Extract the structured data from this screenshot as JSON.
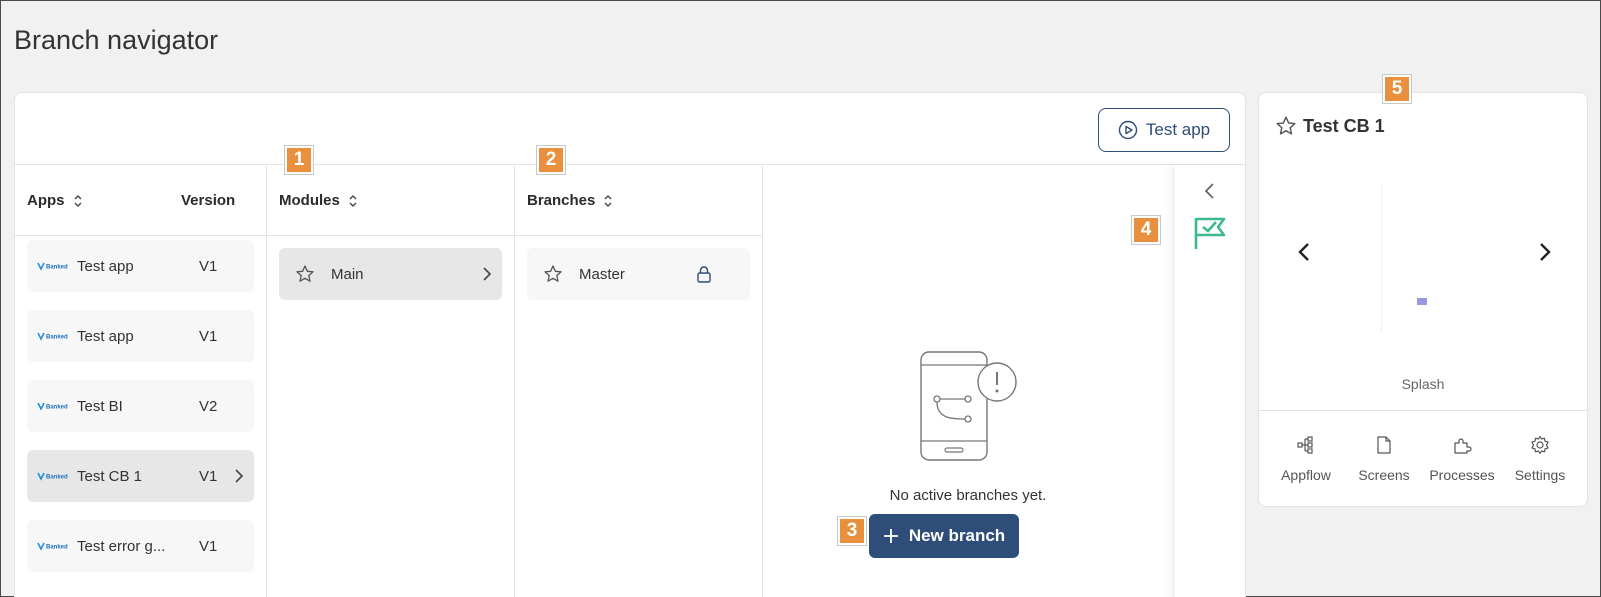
{
  "page": {
    "title": "Branch navigator"
  },
  "toolbar": {
    "test_app_label": "Test app"
  },
  "apps": {
    "header": "Apps",
    "version_header": "Version",
    "items": [
      {
        "name": "Test app",
        "version": "V1"
      },
      {
        "name": "Test app",
        "version": "V1"
      },
      {
        "name": "Test BI",
        "version": "V2"
      },
      {
        "name": "Test CB 1",
        "version": "V1"
      },
      {
        "name": "Test error g...",
        "version": "V1"
      }
    ],
    "logo_text": "Banked"
  },
  "modules": {
    "header": "Modules",
    "items": [
      {
        "name": "Main"
      }
    ]
  },
  "branches": {
    "header": "Branches",
    "items": [
      {
        "name": "Master"
      }
    ]
  },
  "empty_state": {
    "message": "No active branches yet.",
    "new_branch_label": "New branch"
  },
  "badges": [
    "1",
    "2",
    "3",
    "4",
    "5"
  ],
  "preview": {
    "title": "Test CB 1",
    "screen_label": "Splash",
    "tabs": [
      {
        "label": "Appflow",
        "icon": "appflow-icon"
      },
      {
        "label": "Screens",
        "icon": "screens-icon"
      },
      {
        "label": "Processes",
        "icon": "processes-icon"
      },
      {
        "label": "Settings",
        "icon": "settings-icon"
      }
    ]
  },
  "colors": {
    "primary": "#2e4d78",
    "badge": "#e8903e",
    "flag": "#3fb88c"
  }
}
